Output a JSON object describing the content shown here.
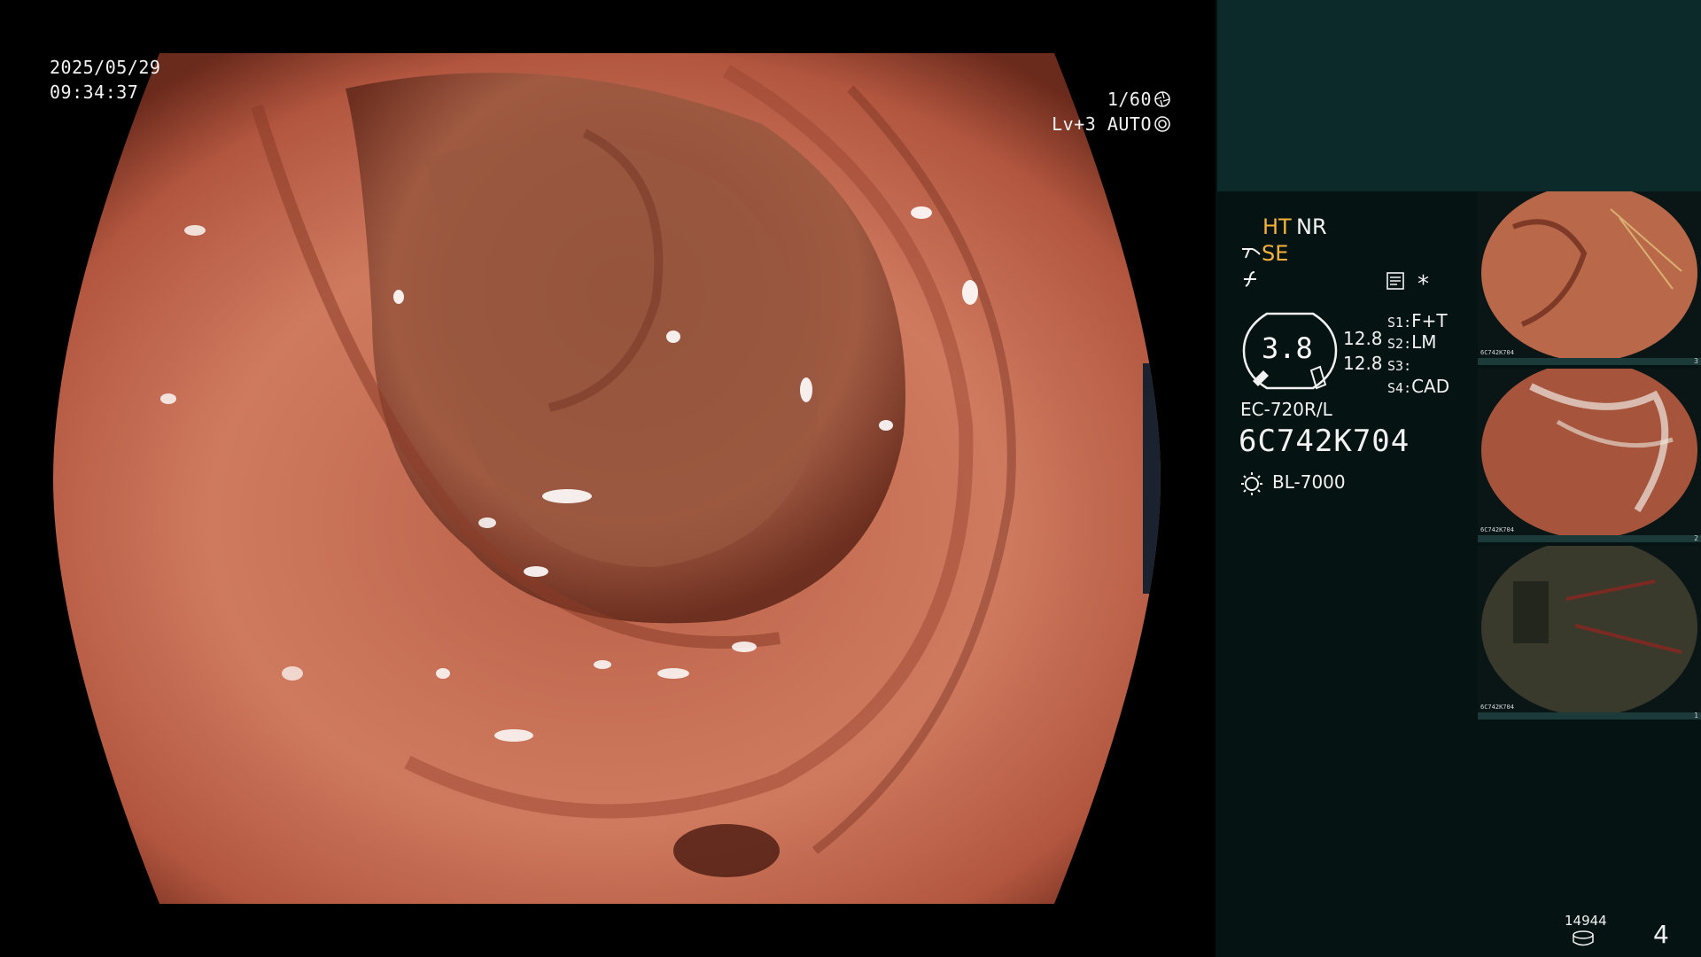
{
  "osd": {
    "date": "2025/05/29",
    "time": "09:34:37",
    "shutter": "1/60",
    "shutter_icon": "aperture-icon",
    "level": "Lv+3 AUTO",
    "auto_icon": "auto-iris-icon"
  },
  "panel": {
    "ht": "HT",
    "nr": "NR",
    "se": "SE",
    "se_icon": "enhancement-icon",
    "f_icon": "freeze-icon",
    "doc_icon": "document-icon",
    "star": "*",
    "gauge_value": "3.8",
    "gauge_icon": "scope-gauge-icon",
    "distance_1": "12.8",
    "distance_2": "12.8",
    "switches": [
      {
        "key": "S1",
        "value": "F+T"
      },
      {
        "key": "S2",
        "value": "LM"
      },
      {
        "key": "S3",
        "value": ""
      },
      {
        "key": "S4",
        "value": "CAD"
      }
    ],
    "scope_model": "EC-720R/L",
    "scope_serial": "6C742K704",
    "light_icon": "light-source-icon",
    "light_source": "BL-7000"
  },
  "thumbnails": [
    {
      "caption": "6C742K704",
      "index": "3",
      "tone": "#b9694a"
    },
    {
      "caption": "6C742K704",
      "index": "2",
      "tone": "#a6553c"
    },
    {
      "caption": "6C742K704",
      "index": "1",
      "tone": "#3a3a2c"
    }
  ],
  "footer": {
    "image_count": "14944",
    "storage_icon": "storage-icon",
    "page_number": "4"
  },
  "colors": {
    "accent_orange": "#f5b33c",
    "panel_bg": "#061313",
    "panel_top": "#0c2a2a",
    "tissue": "#c8705a"
  }
}
